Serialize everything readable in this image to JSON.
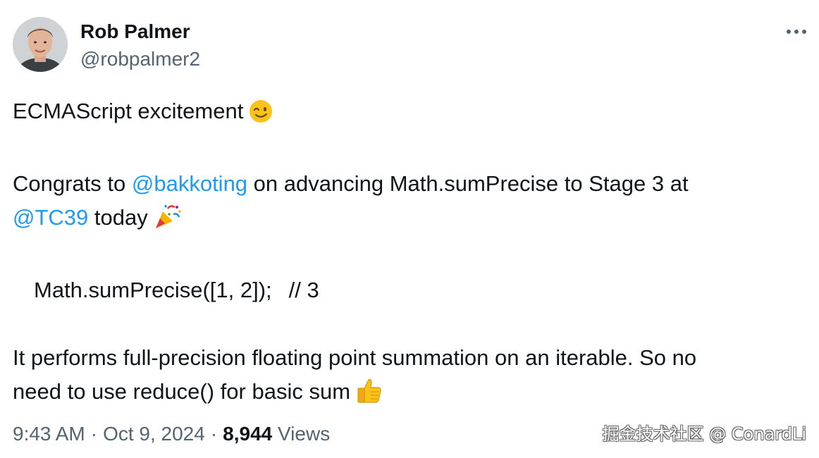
{
  "author": {
    "name": "Rob Palmer",
    "handle": "@robpalmer2"
  },
  "menu": {
    "icon": "more-horizontal-icon"
  },
  "tweet": {
    "line1_text": "ECMAScript excitement",
    "line1_emoji": "winking-face-emoji",
    "line2_prefix": "Congrats to ",
    "line2_mention": "@bakkoting",
    "line2_suffix": " on advancing Math.sumPrecise to Stage 3 at",
    "line3_mention": "@TC39",
    "line3_text": " today",
    "line3_emoji": "party-popper-emoji",
    "code_statement": "Math.sumPrecise([1, 2]);",
    "code_comment": "// 3",
    "line4": "It performs full-precision floating point summation on an iterable. So no",
    "line5_text": "need to use reduce() for basic sum",
    "line5_emoji": "thumbs-up-emoji"
  },
  "meta": {
    "time": "9:43 AM",
    "separator": "·",
    "date": "Oct 9, 2024",
    "views_count": "8,944",
    "views_label": "Views"
  },
  "watermark": "掘金技术社区 @ ConardLi",
  "colors": {
    "link": "#1d9bf0",
    "secondary_text": "#536471",
    "primary_text": "#0f1419"
  }
}
